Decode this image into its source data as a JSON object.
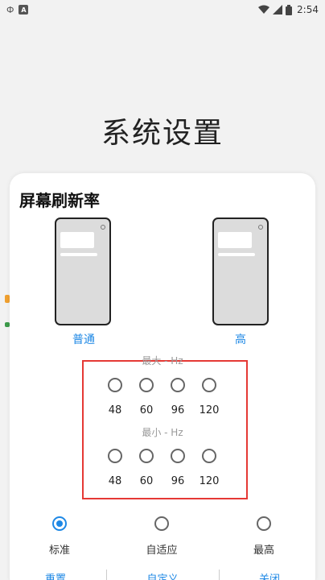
{
  "status_bar": {
    "time": "2:54",
    "left_icon": "Ф",
    "left_badge": "A"
  },
  "page": {
    "title": "系统设置"
  },
  "sheet": {
    "title": "屏幕刷新率",
    "modes": {
      "normal": "普通",
      "high": "高"
    },
    "max_label": "最大 - Hz",
    "min_label": "最小 - Hz",
    "max_options": [
      "48",
      "60",
      "96",
      "120"
    ],
    "min_options": [
      "48",
      "60",
      "96",
      "120"
    ],
    "presets": [
      "标准",
      "自适应",
      "最高"
    ],
    "selected_preset": "标准",
    "actions": [
      "重置",
      "自定义",
      "关闭"
    ]
  },
  "colors": {
    "accent": "#1e88e5",
    "highlight_frame": "#e53935"
  }
}
